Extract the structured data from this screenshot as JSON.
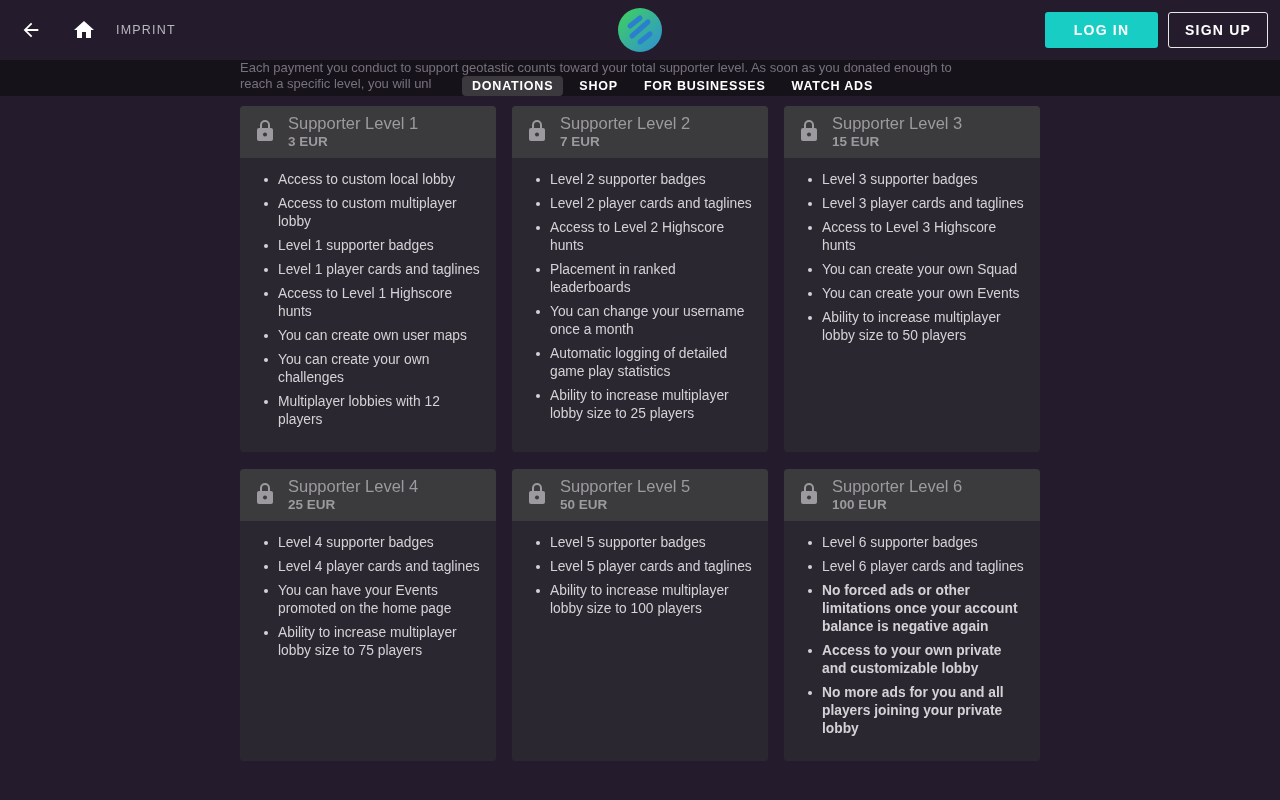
{
  "header": {
    "imprint": "IMPRINT",
    "login": "LOG IN",
    "signup": "SIGN UP"
  },
  "intro": {
    "lines": [
      "Each payment you conduct to support geotastic counts toward your total supporter level. As soon as you donated enough to",
      "reach a specific level, you will unl"
    ]
  },
  "nav": [
    {
      "label": "DONATIONS",
      "selected": true
    },
    {
      "label": "SHOP",
      "selected": false
    },
    {
      "label": "FOR BUSINESSES",
      "selected": false
    },
    {
      "label": "WATCH ADS",
      "selected": false
    }
  ],
  "levels": [
    {
      "title": "Supporter Level 1",
      "price": "3 EUR",
      "locked": true,
      "perks": [
        {
          "text": "Access to custom local lobby",
          "bold": false
        },
        {
          "text": "Access to custom multiplayer lobby",
          "bold": false
        },
        {
          "text": "Level 1 supporter badges",
          "bold": false
        },
        {
          "text": "Level 1 player cards and taglines",
          "bold": false
        },
        {
          "text": "Access to Level 1 Highscore hunts",
          "bold": false
        },
        {
          "text": "You can create own user maps",
          "bold": false
        },
        {
          "text": "You can create your own challenges",
          "bold": false
        },
        {
          "text": "Multiplayer lobbies with 12 players",
          "bold": false
        }
      ]
    },
    {
      "title": "Supporter Level 2",
      "price": "7 EUR",
      "locked": true,
      "perks": [
        {
          "text": "Level 2 supporter badges",
          "bold": false
        },
        {
          "text": "Level 2 player cards and taglines",
          "bold": false
        },
        {
          "text": "Access to Level 2 Highscore hunts",
          "bold": false
        },
        {
          "text": "Placement in ranked leaderboards",
          "bold": false
        },
        {
          "text": "You can change your username once a month",
          "bold": false
        },
        {
          "text": "Automatic logging of detailed game play statistics",
          "bold": false
        },
        {
          "text": "Ability to increase multiplayer lobby size to 25 players",
          "bold": false
        }
      ]
    },
    {
      "title": "Supporter Level 3",
      "price": "15 EUR",
      "locked": true,
      "perks": [
        {
          "text": "Level 3 supporter badges",
          "bold": false
        },
        {
          "text": "Level 3 player cards and taglines",
          "bold": false
        },
        {
          "text": "Access to Level 3 Highscore hunts",
          "bold": false
        },
        {
          "text": "You can create your own Squad",
          "bold": false
        },
        {
          "text": "You can create your own Events",
          "bold": false
        },
        {
          "text": "Ability to increase multiplayer lobby size to 50 players",
          "bold": false
        }
      ]
    },
    {
      "title": "Supporter Level 4",
      "price": "25 EUR",
      "locked": true,
      "perks": [
        {
          "text": "Level 4 supporter badges",
          "bold": false
        },
        {
          "text": "Level 4 player cards and taglines",
          "bold": false
        },
        {
          "text": "You can have your Events promoted on the home page",
          "bold": false
        },
        {
          "text": "Ability to increase multiplayer lobby size to 75 players",
          "bold": false
        }
      ]
    },
    {
      "title": "Supporter Level 5",
      "price": "50 EUR",
      "locked": true,
      "perks": [
        {
          "text": "Level 5 supporter badges",
          "bold": false
        },
        {
          "text": "Level 5 player cards and taglines",
          "bold": false
        },
        {
          "text": "Ability to increase multiplayer lobby size to 100 players",
          "bold": false
        }
      ]
    },
    {
      "title": "Supporter Level 6",
      "price": "100 EUR",
      "locked": true,
      "perks": [
        {
          "text": "Level 6 supporter badges",
          "bold": false
        },
        {
          "text": "Level 6 player cards and taglines",
          "bold": false
        },
        {
          "text": "No forced ads or other limitations once your account balance is negative again",
          "bold": true
        },
        {
          "text": "Access to your own private and customizable lobby",
          "bold": true
        },
        {
          "text": "No more ads for you and all players joining your private lobby",
          "bold": true
        }
      ]
    }
  ]
}
